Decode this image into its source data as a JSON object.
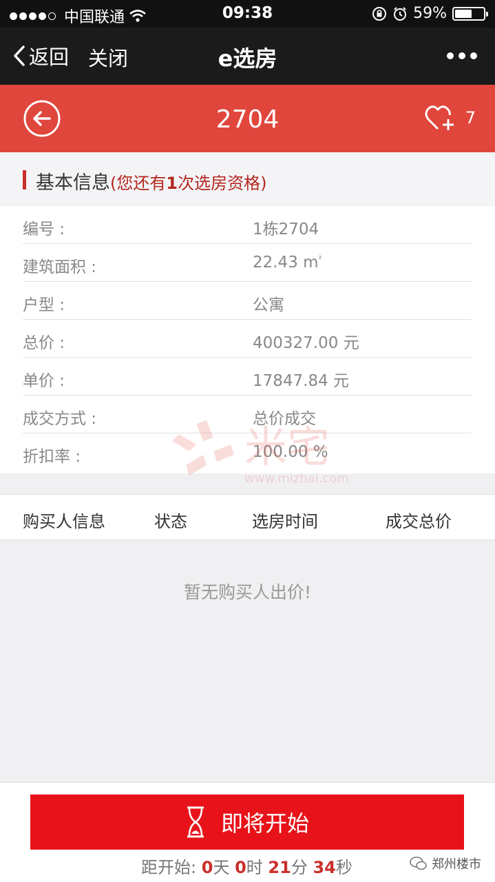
{
  "status": {
    "carrier": "中国联通",
    "time": "09:38",
    "battery": "59%",
    "battery_level": 0.59
  },
  "nav": {
    "back_label": "返回",
    "close_label": "关闭",
    "title": "e选房"
  },
  "header": {
    "room": "2704",
    "fav_count": "7"
  },
  "basic": {
    "title": "基本信息",
    "note_prefix": "(您还有",
    "note_count": "1",
    "note_suffix": "次选房资格)"
  },
  "info_rows": [
    {
      "label": "编号 :",
      "value": "1栋2704"
    },
    {
      "label": "建筑面积 :",
      "value": "22.43 m",
      "sup": "²"
    },
    {
      "label": "户型 :",
      "value": "公寓"
    },
    {
      "label": "总价 :",
      "value": "400327.00 元"
    },
    {
      "label": "单价 :",
      "value": "17847.84 元"
    },
    {
      "label": "成交方式 :",
      "value": "总价成交"
    },
    {
      "label": "折扣率 :",
      "value": "100.00 %"
    }
  ],
  "watermark": {
    "text": "米宅",
    "url": "www.mizhai.com"
  },
  "table": {
    "headers": [
      "购买人信息",
      "状态",
      "选房时间",
      "成交总价"
    ],
    "empty": "暂无购买人出价!"
  },
  "footer": {
    "button_label": "即将开始",
    "countdown_prefix": "距开始:",
    "days": "0",
    "days_unit": "天",
    "hours": "0",
    "hours_unit": "时",
    "minutes": "21",
    "minutes_unit": "分",
    "seconds": "34",
    "seconds_unit": "秒",
    "brand": "郑州楼市"
  }
}
